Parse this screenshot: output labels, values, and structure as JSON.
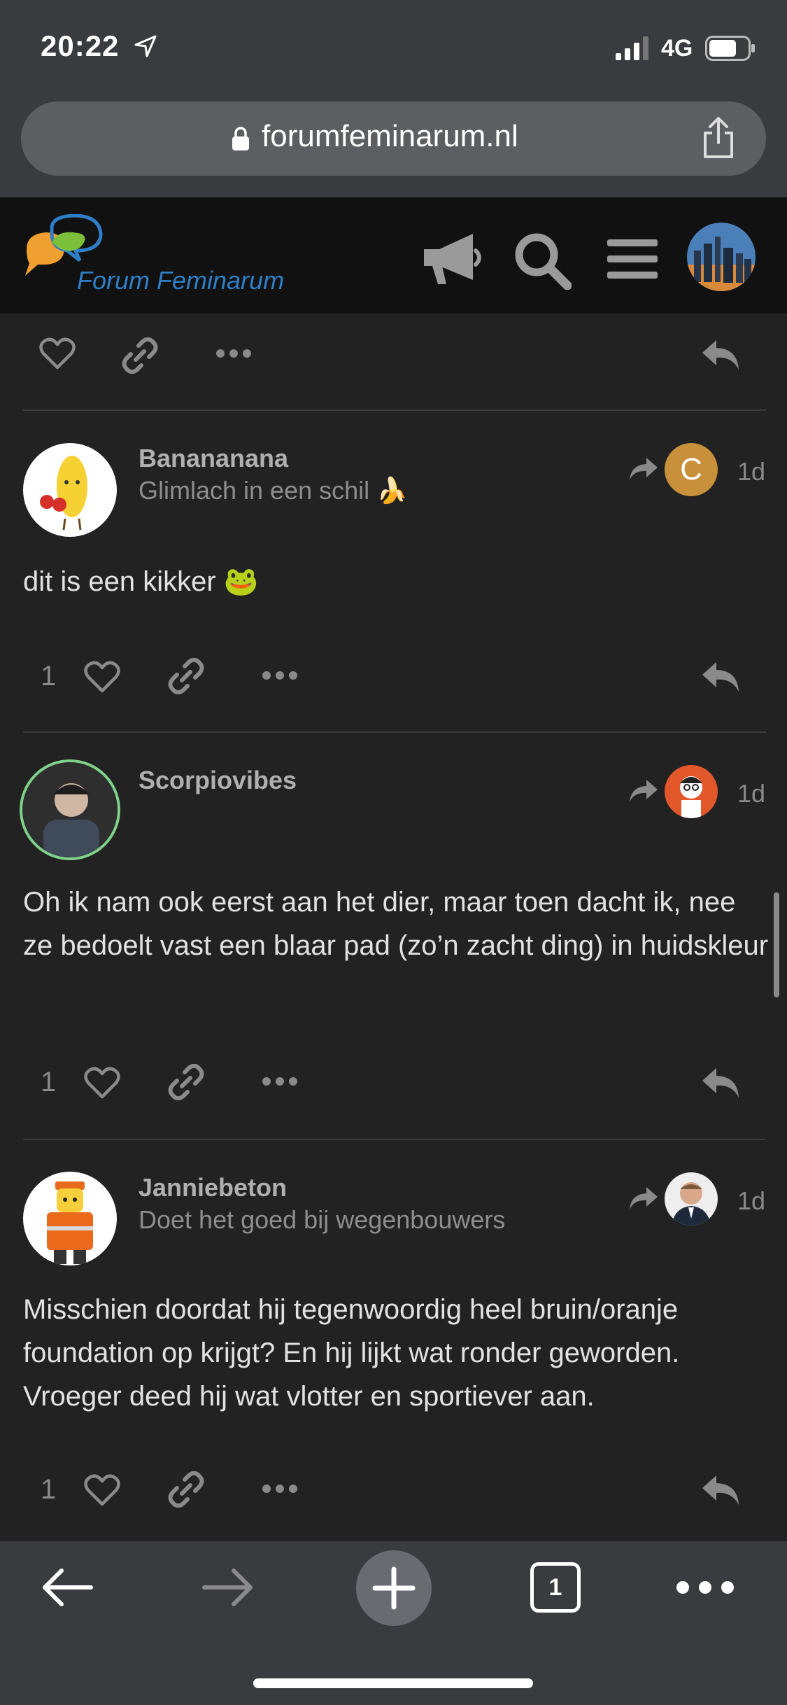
{
  "status_bar": {
    "time": "20:22",
    "network": "4G",
    "battery_level": 0.72
  },
  "browser": {
    "url": "forumfeminarum.nl",
    "tabs_count": "1",
    "icons": {
      "location": "location-arrow-icon",
      "lock": "lock-icon",
      "share": "share-icon",
      "back": "arrow-left-icon",
      "forward": "arrow-right-icon",
      "new_tab": "plus-icon",
      "tabs": "tabs-icon",
      "more": "more-icon"
    }
  },
  "forum": {
    "logo_text": "Forum Feminarum",
    "icons": [
      "megaphone-icon",
      "search-icon",
      "menu-icon",
      "user-avatar"
    ],
    "colors": {
      "logo_blue": "#2e7ec8",
      "logo_green": "#7bbf3a",
      "logo_orange": "#f0a030"
    }
  },
  "posts": [
    {
      "username": "Banananana",
      "user_title": "Glimlach in een schil 🍌",
      "reply_to_initial": "C",
      "reply_to_color": "#c8903a",
      "age": "1d",
      "body": "dit is een kikker 🐸",
      "likes": "1"
    },
    {
      "username": "Scorpiovibes",
      "user_title": "",
      "age": "1d",
      "body": "Oh ik nam ook eerst aan het dier, maar toen dacht ik, nee ze bedoelt vast een blaar pad (zo’n zacht ding) in huidskleur",
      "likes": "1"
    },
    {
      "username": "Janniebeton",
      "user_title": "Doet het goed bij wegenbouwers",
      "age": "1d",
      "body": "Misschien doordat hij tegenwoordig heel bruin/oranje foundation op krijgt? En hij lijkt wat ronder geworden. Vroeger deed hij wat vlotter en sportiever aan.",
      "likes": "1"
    }
  ]
}
